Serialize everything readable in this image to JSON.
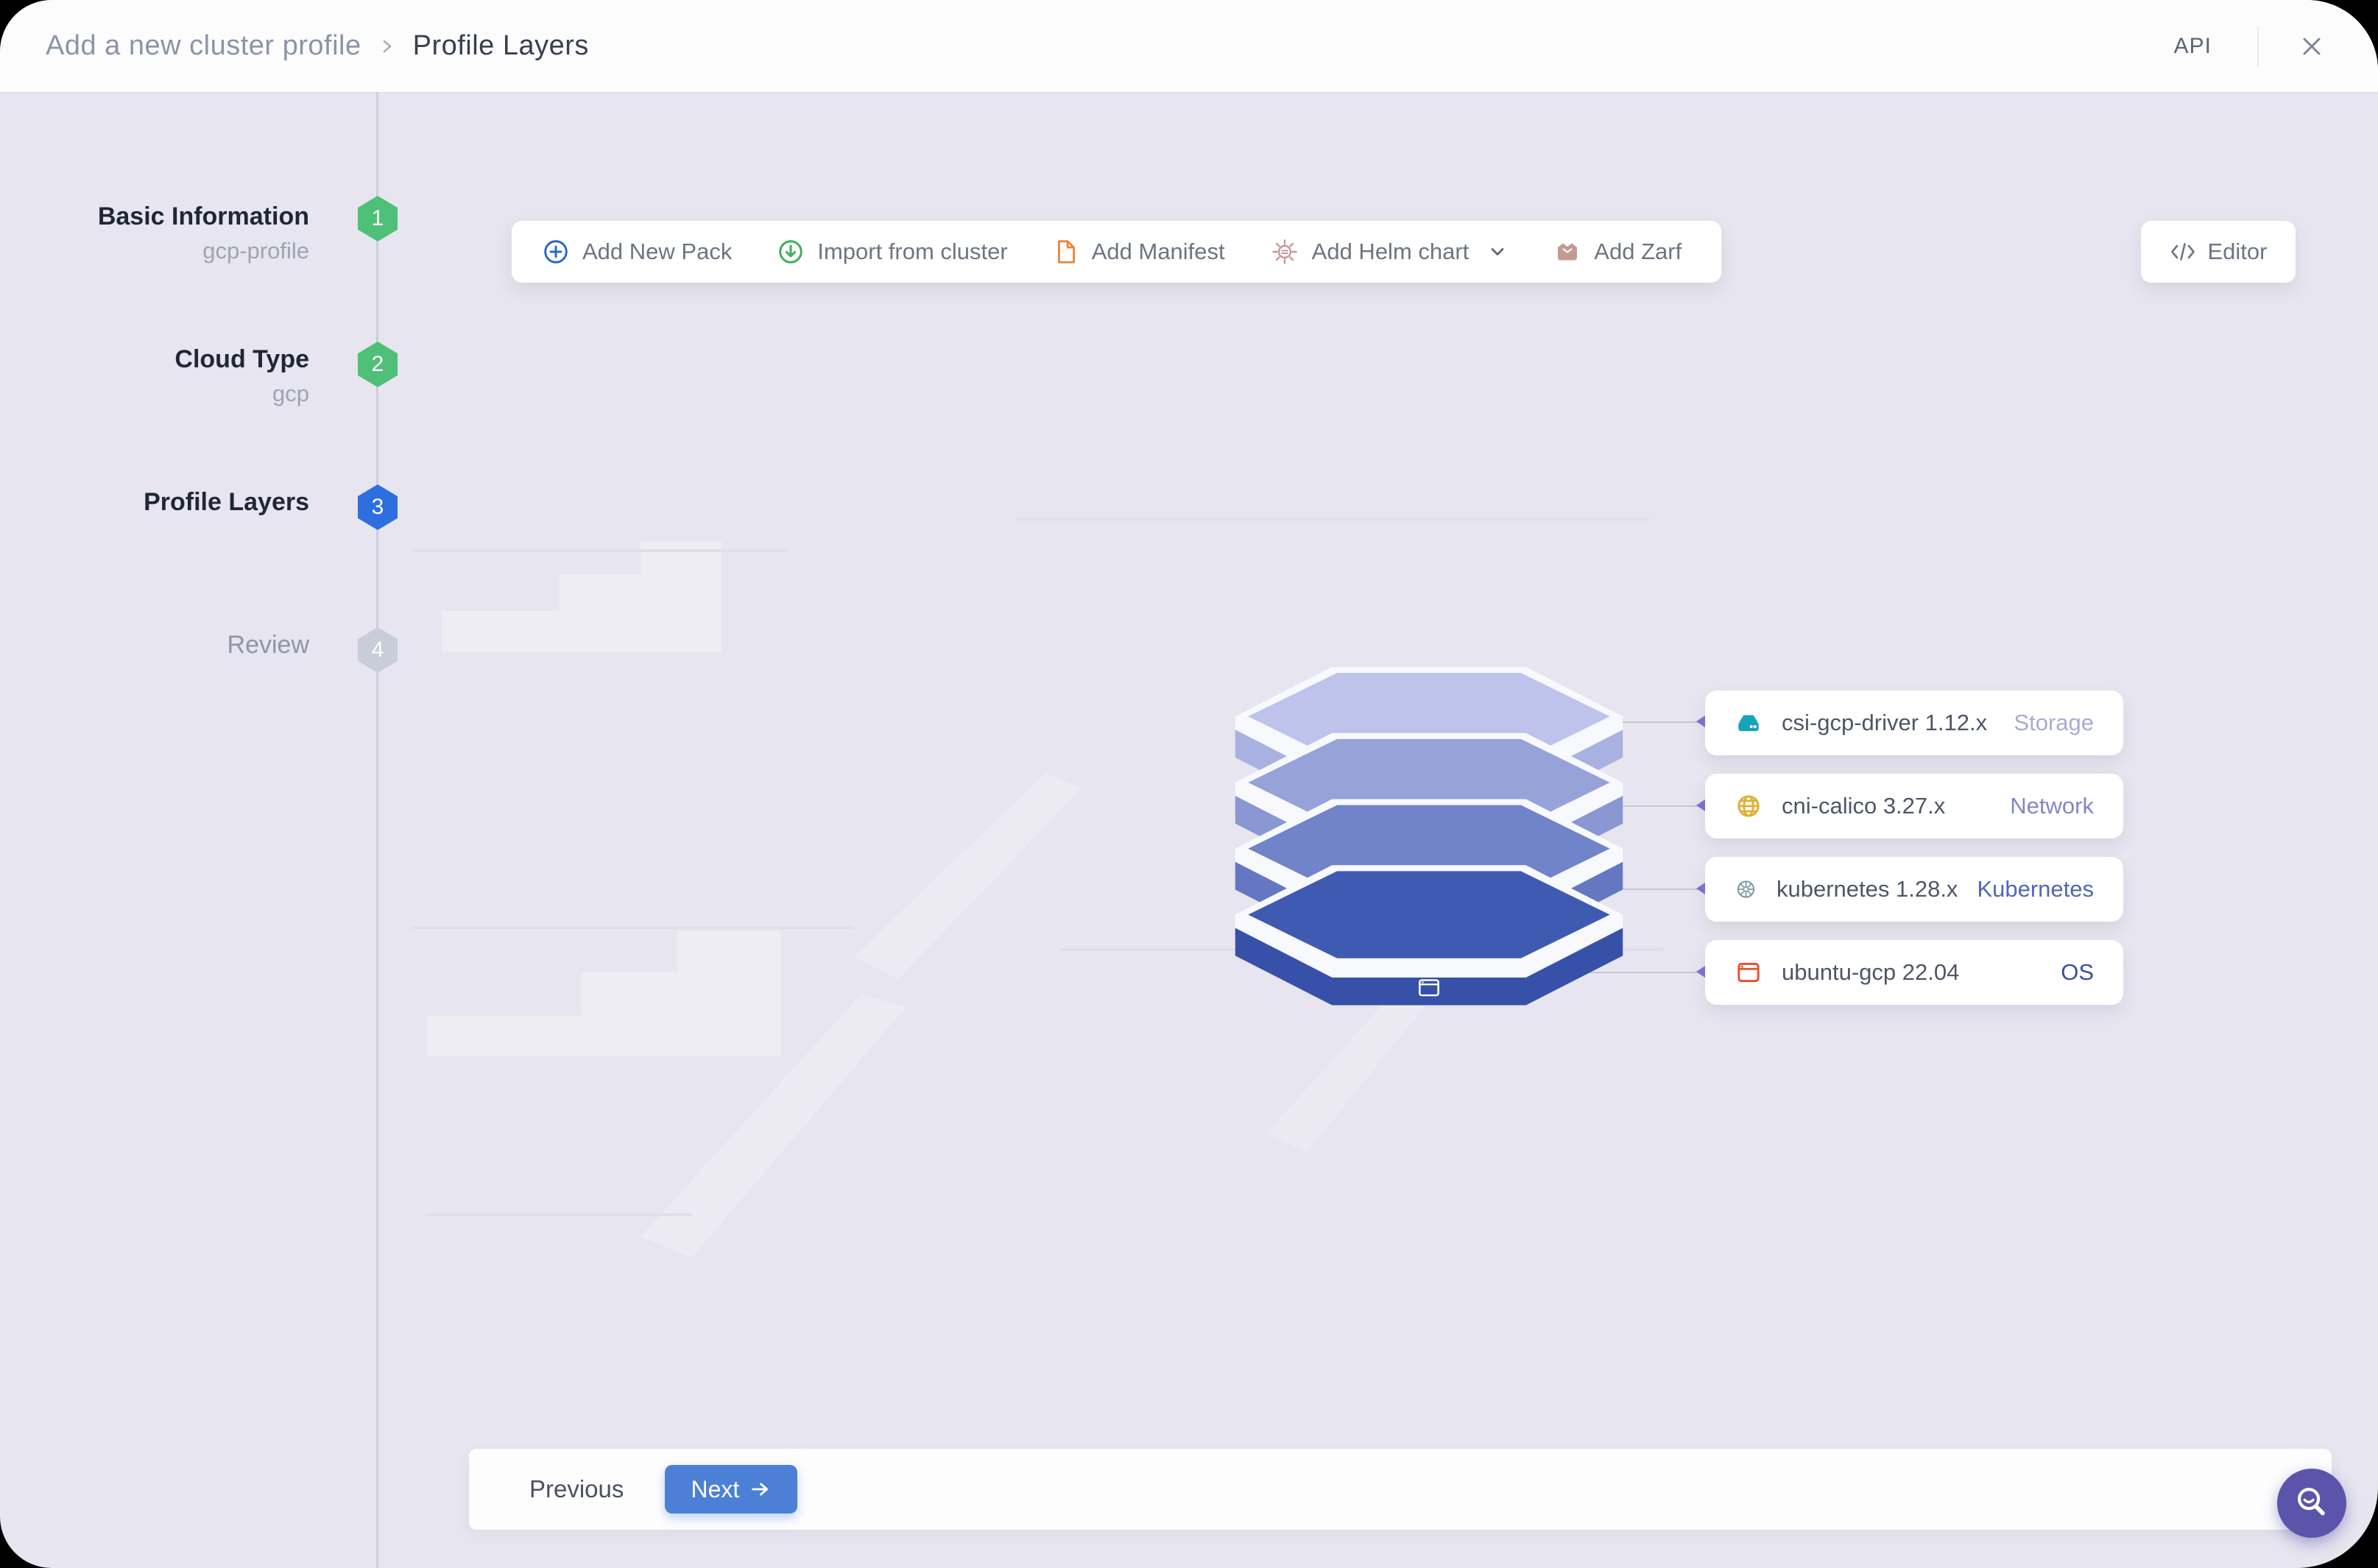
{
  "header": {
    "breadcrumb_parent": "Add a new cluster profile",
    "breadcrumb_current": "Profile Layers",
    "api_label": "API"
  },
  "steps": [
    {
      "label": "Basic Information",
      "sublabel": "gcp-profile",
      "number": "1",
      "status": "done"
    },
    {
      "label": "Cloud Type",
      "sublabel": "gcp",
      "number": "2",
      "status": "done"
    },
    {
      "label": "Profile Layers",
      "sublabel": "",
      "number": "3",
      "status": "active"
    },
    {
      "label": "Review",
      "sublabel": "",
      "number": "4",
      "status": "pending"
    }
  ],
  "toolbar": {
    "items": [
      {
        "label": "Add New Pack",
        "icon": "plus-circle-icon"
      },
      {
        "label": "Import from cluster",
        "icon": "import-icon"
      },
      {
        "label": "Add Manifest",
        "icon": "manifest-icon"
      },
      {
        "label": "Add Helm chart",
        "icon": "helm-icon",
        "has_dropdown": true
      },
      {
        "label": "Add Zarf",
        "icon": "zarf-icon"
      }
    ],
    "editor_label": "Editor"
  },
  "layers": [
    {
      "name": "csi-gcp-driver 1.12.x",
      "category": "Storage",
      "icon": "storage-icon",
      "category_color": "#a7abd4",
      "top_color": "#bdc3ea",
      "front_color": "#a9b1e1"
    },
    {
      "name": "cni-calico 3.27.x",
      "category": "Network",
      "icon": "network-icon",
      "category_color": "#8287c7",
      "top_color": "#97a2d9",
      "front_color": "#8b97d2"
    },
    {
      "name": "kubernetes 1.28.x",
      "category": "Kubernetes",
      "icon": "kubernetes-icon",
      "category_color": "#4f68b2",
      "top_color": "#7183c9",
      "front_color": "#6677c1"
    },
    {
      "name": "ubuntu-gcp 22.04",
      "category": "OS",
      "icon": "os-icon",
      "category_color": "#3a4f9e",
      "top_color": "#3f5ab1",
      "front_color": "#3751a8"
    }
  ],
  "footer": {
    "previous_label": "Previous",
    "next_label": "Next"
  },
  "colors": {
    "background": "#e7e5ef",
    "done_green": "#4fc077",
    "active_blue": "#2e6fe0",
    "pending_gray": "#c8cdd9",
    "next_button_blue": "#4b80d6",
    "fab_purple": "#5a55ab"
  }
}
